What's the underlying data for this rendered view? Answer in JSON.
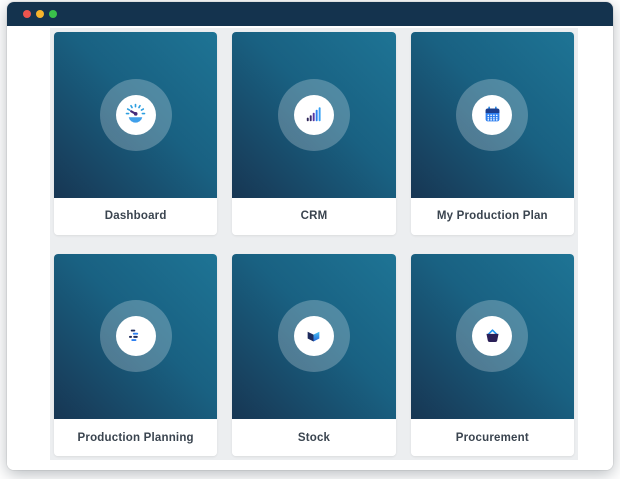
{
  "window": {
    "traffic_lights": [
      {
        "name": "close",
        "color": "#ee544e"
      },
      {
        "name": "minimize",
        "color": "#f6b42c"
      },
      {
        "name": "maximize",
        "color": "#3ac14b"
      }
    ]
  },
  "theme": {
    "titlebar_bg": "#14334e",
    "panel_bg": "#eceef0",
    "tile_gradient_start": "#1e7495",
    "tile_gradient_end": "#173653",
    "label_color": "#3a444f",
    "icon_blue": "#2d7ff0",
    "icon_light_blue": "#35a1f5",
    "icon_dark_navy": "#1d2a5c",
    "icon_indigo": "#2b2058",
    "icon_halo": "rgba(255,255,255,0.24)"
  },
  "grid": {
    "tiles": [
      {
        "label": "Dashboard",
        "icon": "gauge-icon"
      },
      {
        "label": "CRM",
        "icon": "bar-chart-icon"
      },
      {
        "label": "My Production Plan",
        "icon": "calendar-icon"
      },
      {
        "label": "Production Planning",
        "icon": "gantt-chart-icon"
      },
      {
        "label": "Stock",
        "icon": "box-icon"
      },
      {
        "label": "Procurement",
        "icon": "basket-icon"
      }
    ]
  }
}
